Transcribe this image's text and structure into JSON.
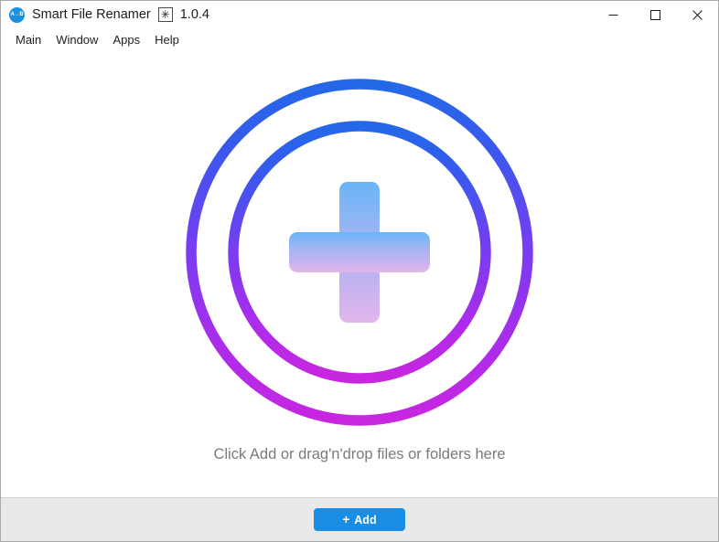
{
  "window": {
    "title": "Smart File Renamer",
    "badge": "✳",
    "version": "1.0.4",
    "icon_name": "app-logo-icon",
    "icon_text": "A→B",
    "controls": {
      "minimize": "Minimize",
      "maximize": "Maximize",
      "close": "Close"
    }
  },
  "menu": {
    "items": [
      {
        "label": "Main"
      },
      {
        "label": "Window"
      },
      {
        "label": "Apps"
      },
      {
        "label": "Help"
      }
    ]
  },
  "drop_area": {
    "logo_name": "add-files-circle-plus-graphic",
    "hint": "Click Add or drag'n'drop files or folders here"
  },
  "footer": {
    "add_plus": "+",
    "add_label": "Add"
  },
  "colors": {
    "ring_top": "#2468e8",
    "ring_mid": "#7a3cf0",
    "ring_bottom": "#c926e0",
    "plus_top": "#69b5f7",
    "plus_mid": "#a9b5f2",
    "plus_bottom": "#e3b6ec",
    "accent_button": "#1a8ee5",
    "hint_text": "#7a7a7a",
    "footer_bg": "#e9e9e9"
  }
}
